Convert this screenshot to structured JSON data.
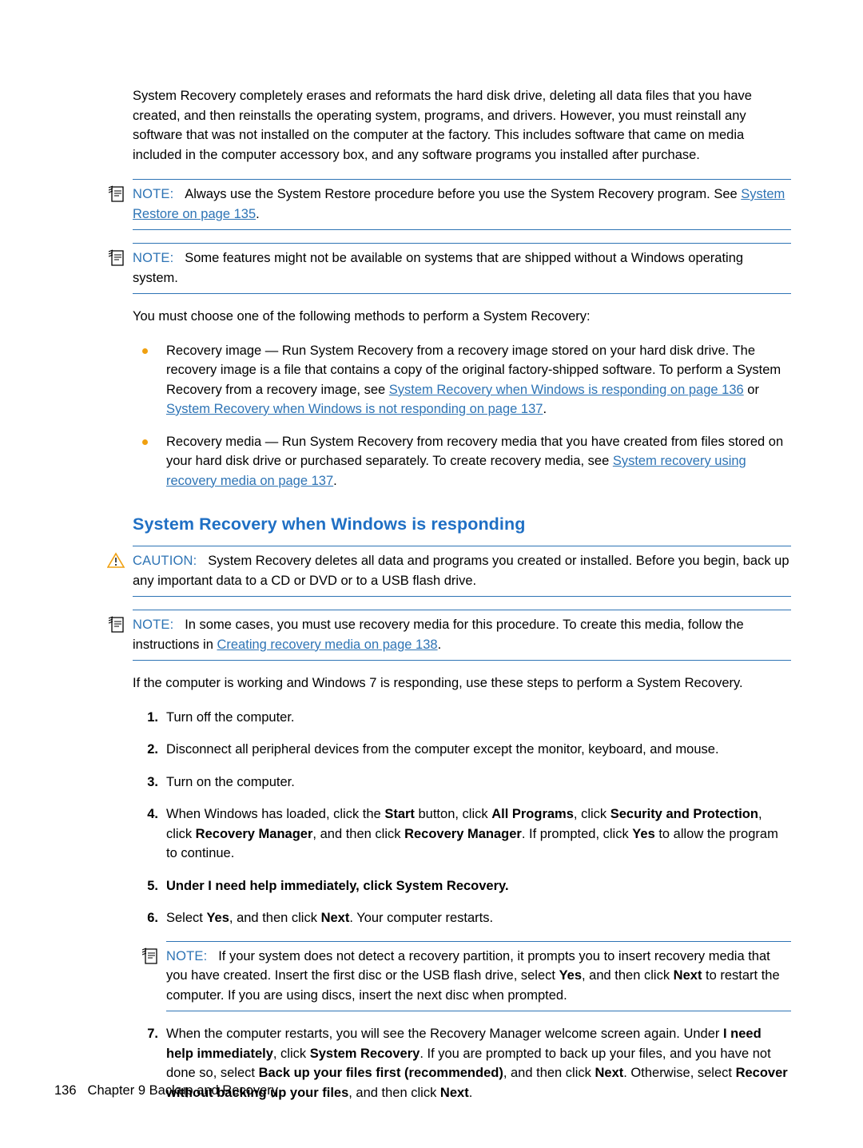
{
  "page": {
    "intro": "System Recovery completely erases and reformats the hard disk drive, deleting all data files that you have created, and then reinstalls the operating system, programs, and drivers. However, you must reinstall any software that was not installed on the computer at the factory. This includes software that came on media included in the computer accessory box, and any software programs you installed after purchase.",
    "note1": {
      "label": "NOTE:",
      "text_before": "Always use the System Restore procedure before you use the System Recovery program. See ",
      "link": "System Restore on page 135",
      "text_after": "."
    },
    "note2": {
      "label": "NOTE:",
      "text": "Some features might not be available on systems that are shipped without a Windows operating system."
    },
    "methods_intro": "You must choose one of the following methods to perform a System Recovery:",
    "bullets": [
      {
        "part1": "Recovery image — Run System Recovery from a recovery image stored on your hard disk drive. The recovery image is a file that contains a copy of the original factory-shipped software. To perform a System Recovery from a recovery image, see ",
        "link1": "System Recovery when Windows is responding on page 136",
        "mid": " or ",
        "link2": "System Recovery when Windows is not responding on page 137",
        "part2": "."
      },
      {
        "part1": "Recovery media — Run System Recovery from recovery media that you have created from files stored on your hard disk drive or purchased separately. To create recovery media, see ",
        "link1": "System recovery using recovery media on page 137",
        "part2": "."
      }
    ],
    "heading": "System Recovery when Windows is responding",
    "caution": {
      "label": "CAUTION:",
      "text": "System Recovery deletes all data and programs you created or installed. Before you begin, back up any important data to a CD or DVD or to a USB flash drive."
    },
    "note3": {
      "label": "NOTE:",
      "text_before": "In some cases, you must use recovery media for this procedure. To create this media, follow the instructions in ",
      "link": "Creating recovery media on page 138",
      "text_after": "."
    },
    "steps_intro": "If the computer is working and Windows 7 is responding, use these steps to perform a System Recovery.",
    "steps": [
      {
        "num": "1.",
        "text": "Turn off the computer."
      },
      {
        "num": "2.",
        "text": "Disconnect all peripheral devices from the computer except the monitor, keyboard, and mouse."
      },
      {
        "num": "3.",
        "text": "Turn on the computer."
      },
      {
        "num": "4.",
        "text": "When Windows has loaded, click the Start button, click All Programs, click Security and Protection, click Recovery Manager, and then click Recovery Manager. If prompted, click Yes to allow the program to continue."
      },
      {
        "num": "5.",
        "text": "Under I need help immediately, click System Recovery."
      },
      {
        "num": "6.",
        "text": "Select Yes, and then click Next. Your computer restarts."
      },
      {
        "num": "7.",
        "text": "When the computer restarts, you will see the Recovery Manager welcome screen again. Under I need help immediately, click System Recovery. If you are prompted to back up your files, and you have not done so, select Back up your files first (recommended), and then click Next. Otherwise, select Recover without backing up your files, and then click Next."
      }
    ],
    "note4": {
      "label": "NOTE:",
      "text": "If your system does not detect a recovery partition, it prompts you to insert recovery media that you have created. Insert the first disc or the USB flash drive, select Yes, and then click Next to restart the computer. If you are using discs, insert the next disc when prompted."
    },
    "footer": {
      "page_number": "136",
      "chapter": "Chapter 9   Backup and Recovery"
    },
    "colors": {
      "link": "#2e74b5",
      "heading": "#1f6fc4",
      "bullet": "#f0a010",
      "caution_icon": "#f0a010"
    }
  }
}
